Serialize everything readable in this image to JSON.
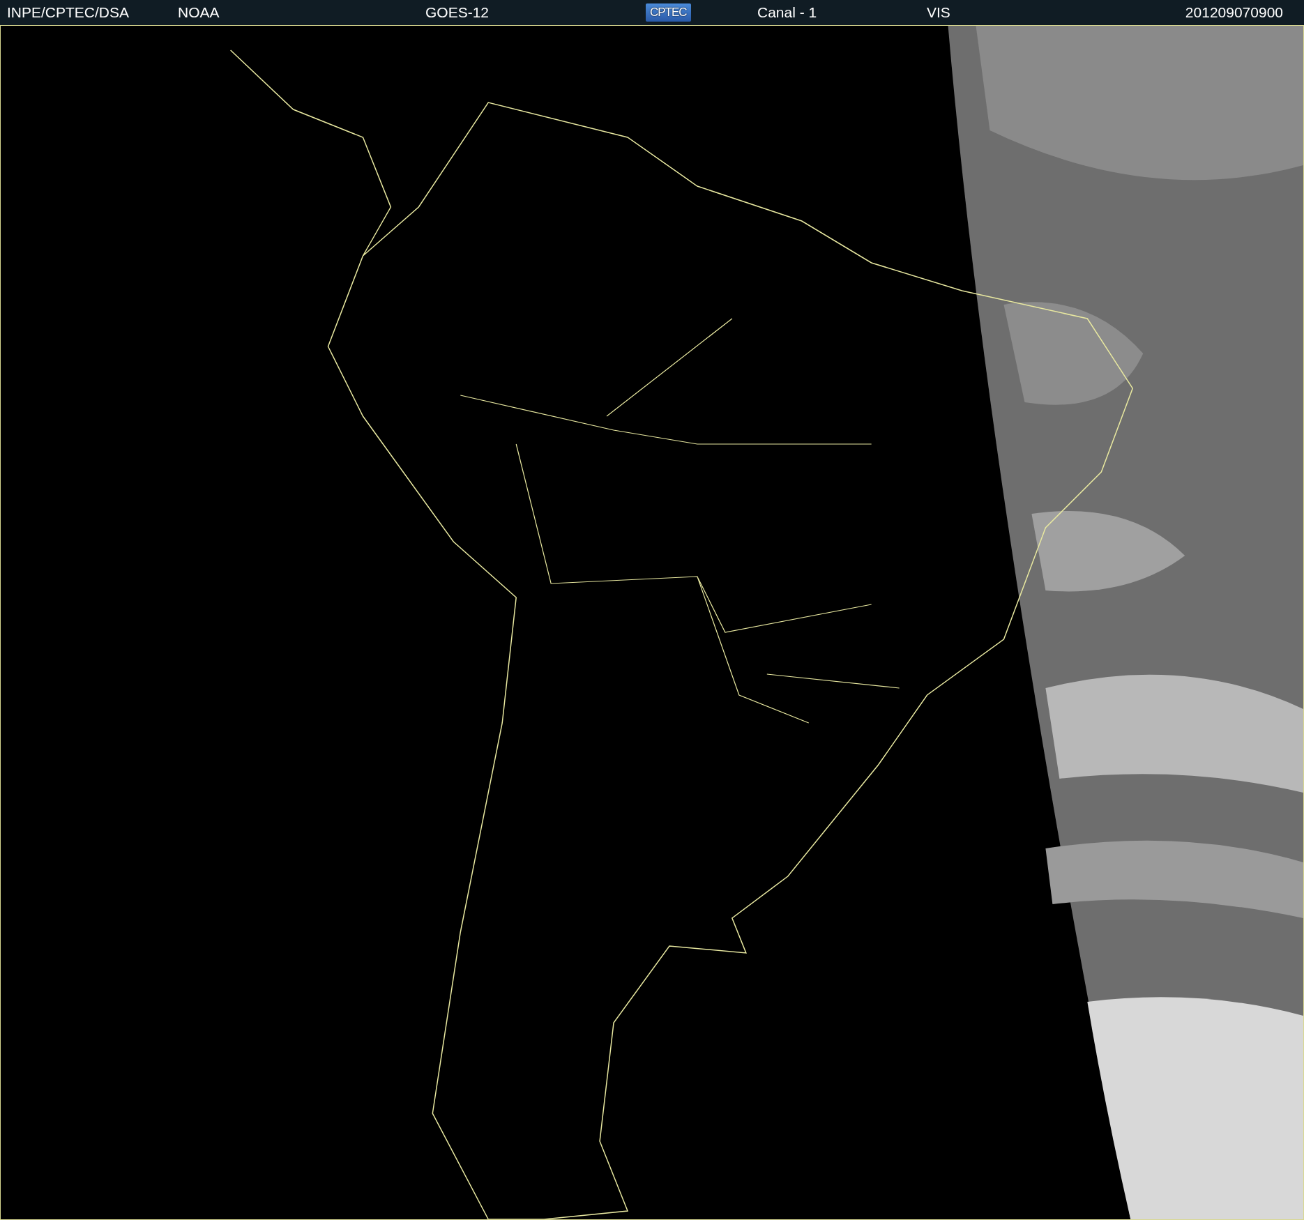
{
  "header": {
    "items": [
      {
        "text": "INPE/CPTEC/DSA",
        "kind": "text"
      },
      {
        "text": "NOAA",
        "kind": "text"
      },
      {
        "text": "GOES-12",
        "kind": "text"
      },
      {
        "text": "CPTEC",
        "kind": "logo"
      },
      {
        "text": "Canal - 1",
        "kind": "text"
      },
      {
        "text": "VIS",
        "kind": "text"
      },
      {
        "text": "201209070900",
        "kind": "text"
      }
    ]
  }
}
